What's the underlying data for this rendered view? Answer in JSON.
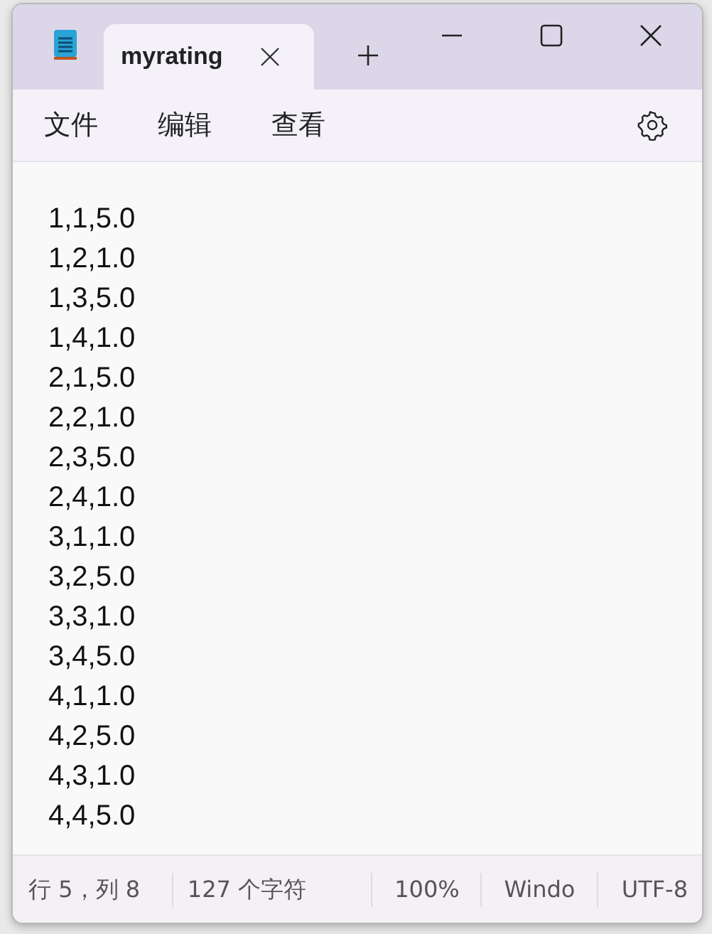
{
  "tabs": [
    {
      "title": "myrating",
      "selected": true
    }
  ],
  "menu": [
    "文件",
    "编辑",
    "查看"
  ],
  "lines": [
    "1,1,5.0",
    "1,2,1.0",
    "1,3,5.0",
    "1,4,1.0",
    "2,1,5.0",
    "2,2,1.0",
    "2,3,5.0",
    "2,4,1.0",
    "3,1,1.0",
    "3,2,5.0",
    "3,3,1.0",
    "3,4,5.0",
    "4,1,1.0",
    "4,2,5.0",
    "4,3,1.0",
    "4,4,5.0"
  ],
  "status_bar": [
    "行 5，列 8",
    "127 个字符",
    "100%",
    "Windo",
    "UTF-8"
  ]
}
